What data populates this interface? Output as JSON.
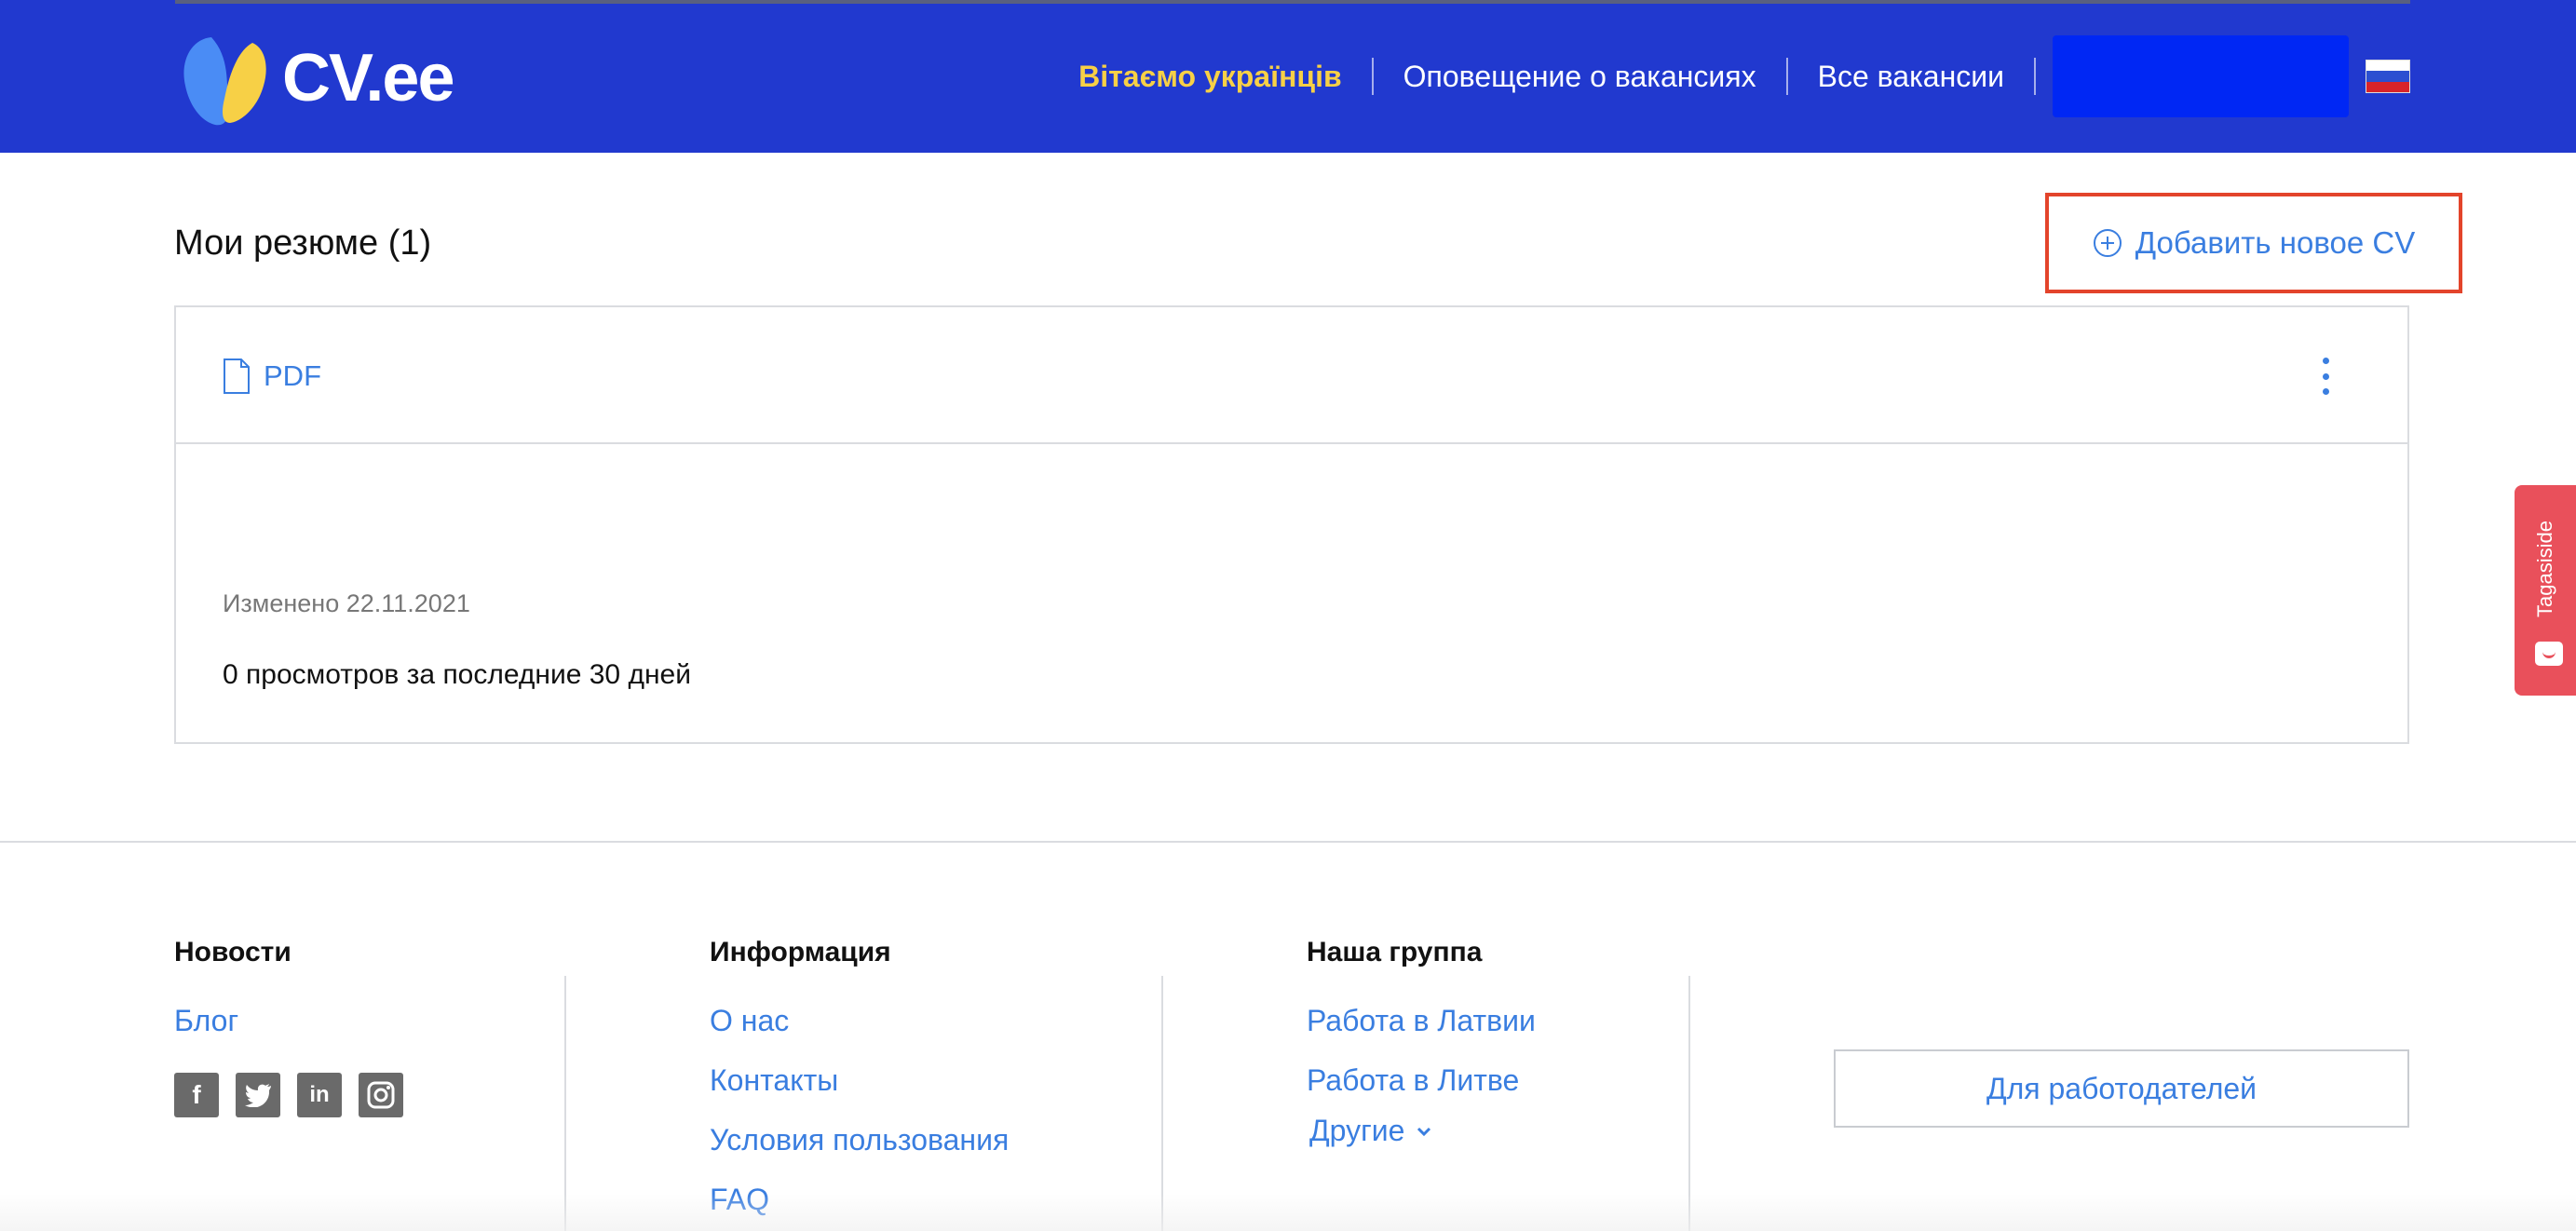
{
  "header": {
    "logo_text": "CV.ee",
    "nav": {
      "welcome": "Вітаємо українців",
      "job_alerts": "Оповещение о вакансиях",
      "all_jobs": "Все вакансии"
    },
    "colors": {
      "background": "#2139cf",
      "welcome": "#f7d046"
    }
  },
  "main": {
    "title": "Мои резюме (1)",
    "add_button": "Добавить новое CV",
    "card": {
      "file_type": "PDF",
      "modified": "Изменено 22.11.2021",
      "views": "0 просмотров за последние 30 дней"
    }
  },
  "feedback": {
    "label": "Tagasiside"
  },
  "footer": {
    "news": {
      "title": "Новости",
      "blog": "Блог",
      "social": [
        "f",
        "t",
        "in",
        "ig"
      ]
    },
    "info": {
      "title": "Информация",
      "links": [
        "О нас",
        "Контакты",
        "Условия пользования",
        "FAQ"
      ]
    },
    "group": {
      "title": "Наша группа",
      "links": [
        "Работа в Латвии",
        "Работа в Литве"
      ],
      "other": "Другие"
    },
    "employers_button": "Для работодателей"
  }
}
